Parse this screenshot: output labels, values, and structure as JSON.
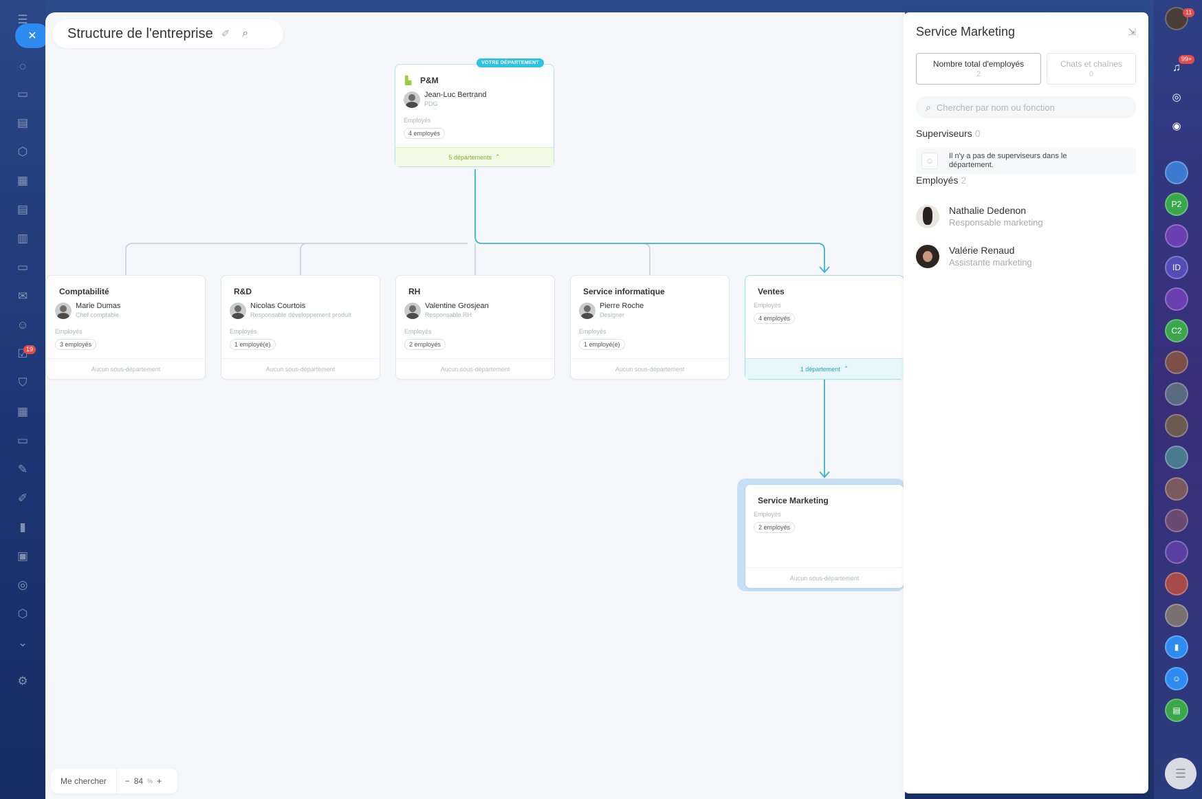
{
  "app": {
    "title": "Structure de l'entreprise"
  },
  "left_rail": {
    "icons": [
      "menu-icon",
      "chat-icon",
      "messages-icon",
      "feed-icon",
      "groups-icon",
      "calendar-icon",
      "documents-icon",
      "boards-icon",
      "drive-icon",
      "mail-icon",
      "contacts-icon",
      "tasks-icon",
      "crm-icon",
      "automation-icon",
      "store-icon",
      "sign-icon",
      "sites-icon",
      "analytics-icon",
      "marketing-icon",
      "helpdesk-icon",
      "box-icon",
      "chevron-down-icon",
      "settings-icon"
    ],
    "tasks_badge": "19"
  },
  "org": {
    "root": {
      "name": "P&M",
      "badge": "VOTRE DÉPARTEMENT",
      "head_name": "Jean-Luc Bertrand",
      "head_role": "PDG",
      "employees_label": "Employés",
      "employees_count": "4 employés",
      "footer": "5 départements"
    },
    "children": [
      {
        "name": "Comptabilité",
        "head_name": "Marie Dumas",
        "head_role": "Chef comptable",
        "employees_label": "Employés",
        "employees_count": "3 employés",
        "footer": "Aucun sous-département"
      },
      {
        "name": "R&D",
        "head_name": "Nicolas Courtois",
        "head_role": "Responsable développement produit",
        "employees_label": "Employés",
        "employees_count": "1 employé(e)",
        "footer": "Aucun sous-département"
      },
      {
        "name": "RH",
        "head_name": "Valentine Grosjean",
        "head_role": "Responsable RH",
        "employees_label": "Employés",
        "employees_count": "2 employés",
        "footer": "Aucun sous-département"
      },
      {
        "name": "Service informatique",
        "head_name": "Pierre Roche",
        "head_role": "Designer",
        "employees_label": "Employés",
        "employees_count": "1 employé(e)",
        "footer": "Aucun sous-département"
      },
      {
        "name": "Ventes",
        "employees_label": "Employés",
        "employees_count": "4 employés",
        "footer": "1 département"
      }
    ],
    "grandchild": {
      "name": "Service Marketing",
      "employees_label": "Employés",
      "employees_count": "2 employés",
      "footer": "Aucun sous-département"
    }
  },
  "bottom_bar": {
    "find_me": "Me chercher",
    "zoom_minus": "−",
    "zoom_value": "84",
    "zoom_unit": "%",
    "zoom_plus": "+"
  },
  "panel": {
    "title": "Service Marketing",
    "tabs": [
      {
        "label": "Nombre total d'employés",
        "count": "2"
      },
      {
        "label": "Chats et chaînes",
        "count": "0"
      }
    ],
    "search_placeholder": "Chercher par nom ou fonction",
    "supervisors_label": "Superviseurs",
    "supervisors_count": "0",
    "no_supervisors": "Il n'y a pas de superviseurs dans le département.",
    "employees_label": "Employés",
    "employees_count": "2",
    "employees": [
      {
        "name": "Nathalie Dedenon",
        "role": "Responsable marketing"
      },
      {
        "name": "Valérie Renaud",
        "role": "Assistante marketing"
      }
    ]
  },
  "right_rail": {
    "notifications_badge": "99+",
    "top_badge": "11",
    "items": [
      "P2",
      "ID",
      "C2"
    ]
  },
  "colors": {
    "accent": "#2ec3e6",
    "line_active": "#3bb3d4",
    "line_inactive": "#c9ced5",
    "rail_blue": "#2e8cf0"
  }
}
